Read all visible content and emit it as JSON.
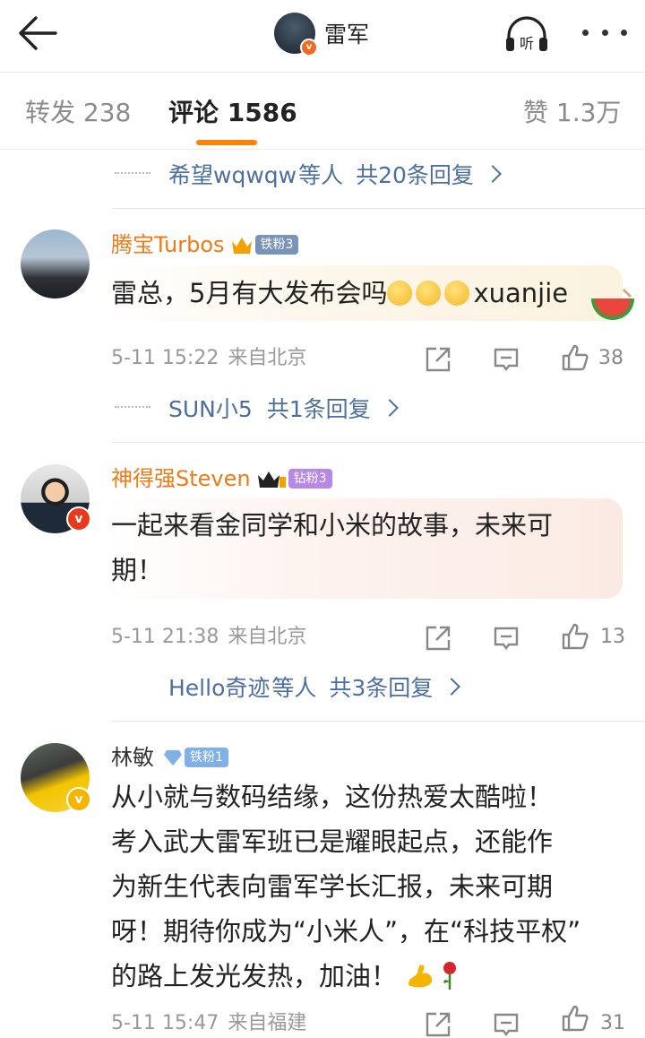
{
  "header": {
    "title": "雷军",
    "listen_label": "听"
  },
  "tabs": {
    "repost": "转发 238",
    "comments": "评论 1586",
    "likes": "赞 1.3万"
  },
  "prev_replies": {
    "names": "希望wqwqw",
    "tail": "等人",
    "count": "共20条回复"
  },
  "comments": [
    {
      "user": "腾宝Turbos",
      "badge": "铁粉3",
      "text": "雷总，5月有大发布会吗",
      "text_tail": "xuanjie",
      "time": "5-11 15:22",
      "location": "来自北京",
      "likes": "38",
      "replies": {
        "names": "SUN小5",
        "tail": "",
        "count": "共1条回复"
      }
    },
    {
      "user": "神得强Steven",
      "badge": "钻粉3",
      "text": "一起来看金同学和小米的故事，未来可\n期！",
      "time": "5-11 21:38",
      "location": "来自北京",
      "likes": "13",
      "replies": {
        "names": "Hello奇迹",
        "tail": "等人",
        "count": "共3条回复"
      }
    },
    {
      "user": "林敏",
      "badge": "铁粉1",
      "text": "从小就与数码结缘，这份热爱太酷啦！\n考入武大雷军班已是耀眼起点，还能作\n为新生代表向雷军学长汇报，未来可期\n呀！期待你成为“小米人”，在“科技平权”\n的路上发光发热，加油！",
      "time": "5-11 15:47",
      "location": "来自福建",
      "likes": "31"
    }
  ],
  "icons": {
    "back": "back-arrow-icon",
    "listen": "headphones-icon",
    "more": "more-icon",
    "share": "share-icon",
    "comment": "comment-icon",
    "like": "thumbs-up-icon"
  },
  "colors": {
    "accent": "#ff8200",
    "link": "#4d6f9e",
    "username": "#ef7a16"
  }
}
